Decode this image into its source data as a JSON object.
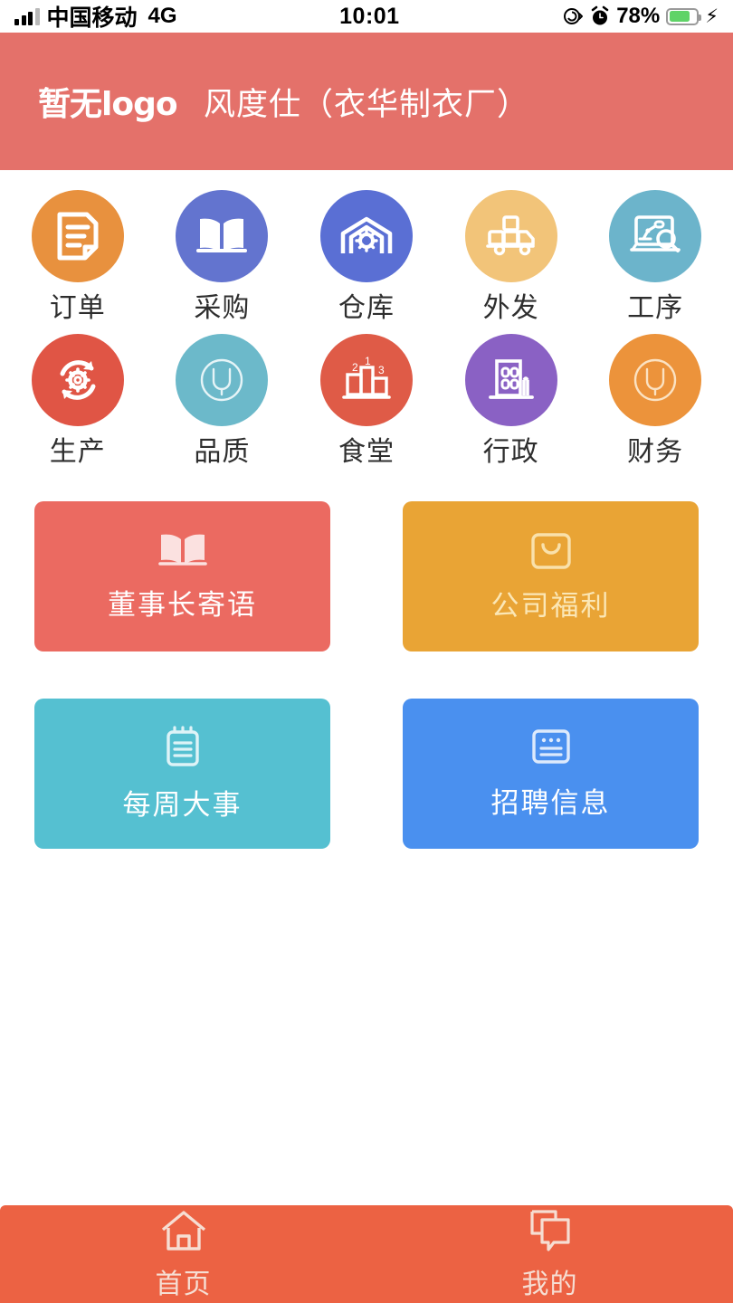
{
  "status_bar": {
    "signal_icon": "signal-bars-icon",
    "carrier": "中国移动",
    "network": "4G",
    "time": "10:01",
    "rotation_lock_icon": "rotation-lock-icon",
    "alarm_icon": "alarm-clock-icon",
    "battery_percent": "78%",
    "battery_icon": "battery-icon",
    "charging_icon": "lightning-bolt-icon"
  },
  "header": {
    "logo_text": "暂无logo",
    "title": "风度仕（衣华制衣厂）",
    "background_color": "#e4716a"
  },
  "apps": [
    {
      "label": "订单",
      "icon": "document-icon",
      "color": "#e8913e"
    },
    {
      "label": "采购",
      "icon": "open-book-icon",
      "color": "#6374cf"
    },
    {
      "label": "仓库",
      "icon": "warehouse-gear-icon",
      "color": "#5a6fd4"
    },
    {
      "label": "外发",
      "icon": "delivery-truck-icon",
      "color": "#f2c479"
    },
    {
      "label": "工序",
      "icon": "laptop-robot-search-icon",
      "color": "#6cb4cb"
    },
    {
      "label": "生产",
      "icon": "gear-refresh-icon",
      "color": "#e05545"
    },
    {
      "label": "品质",
      "icon": "circled-v-icon",
      "color": "#6cb9ca"
    },
    {
      "label": "食堂",
      "icon": "podium-ranking-icon",
      "color": "#df5b47"
    },
    {
      "label": "行政",
      "icon": "office-building-icon",
      "color": "#8a61c4"
    },
    {
      "label": "财务",
      "icon": "circled-v-icon",
      "color": "#ec933b"
    }
  ],
  "cards": [
    {
      "label": "董事长寄语",
      "icon": "open-book-icon",
      "color": "#eb6a61"
    },
    {
      "label": "公司福利",
      "icon": "shopping-bag-icon",
      "color": "#e9a435"
    },
    {
      "label": "每周大事",
      "icon": "clipboard-icon",
      "color": "#55c0d1"
    },
    {
      "label": "招聘信息",
      "icon": "news-article-icon",
      "color": "#4a90ef"
    }
  ],
  "tabbar": {
    "background_color": "#ec6243",
    "items": [
      {
        "label": "首页",
        "icon": "home-icon"
      },
      {
        "label": "我的",
        "icon": "chat-bubbles-icon"
      }
    ]
  }
}
